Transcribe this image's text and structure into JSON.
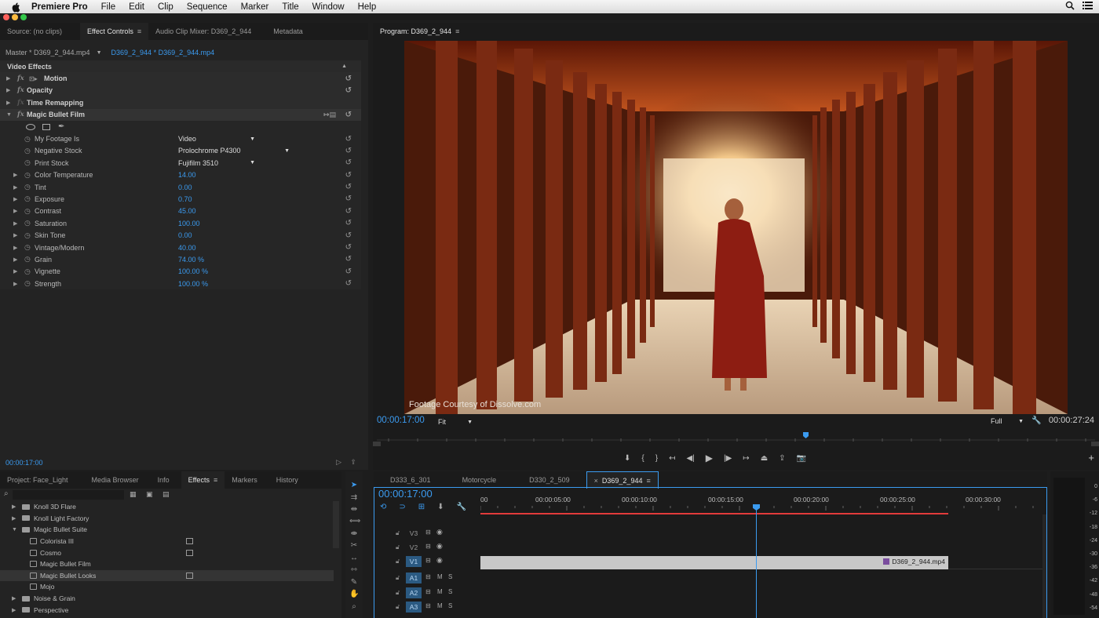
{
  "menubar": {
    "app": "Premiere Pro",
    "items": [
      "File",
      "Edit",
      "Clip",
      "Sequence",
      "Marker",
      "Title",
      "Window",
      "Help"
    ]
  },
  "effect_controls_panel": {
    "tabs": [
      {
        "label": "Source: (no clips)",
        "active": false
      },
      {
        "label": "Effect Controls",
        "active": true
      },
      {
        "label": "Audio Clip Mixer: D369_2_944",
        "active": false
      },
      {
        "label": "Metadata",
        "active": false
      }
    ],
    "master_label": "Master * D369_2_944.mp4",
    "clip_label": "D369_2_944 * D369_2_944.mp4",
    "section": "Video Effects",
    "effects": [
      "Motion",
      "Opacity",
      "Time Remapping",
      "Magic Bullet Film"
    ],
    "dropdowns": [
      {
        "label": "My Footage Is",
        "value": "Video"
      },
      {
        "label": "Negative Stock",
        "value": "Prolochrome P4300"
      },
      {
        "label": "Print Stock",
        "value": "Fujifilm 3510"
      }
    ],
    "params": [
      {
        "label": "Color Temperature",
        "value": "14.00"
      },
      {
        "label": "Tint",
        "value": "0.00"
      },
      {
        "label": "Exposure",
        "value": "0.70"
      },
      {
        "label": "Contrast",
        "value": "45.00"
      },
      {
        "label": "Saturation",
        "value": "100.00"
      },
      {
        "label": "Skin Tone",
        "value": "0.00"
      },
      {
        "label": "Vintage/Modern",
        "value": "40.00"
      },
      {
        "label": "Grain",
        "value": "74.00 %"
      },
      {
        "label": "Vignette",
        "value": "100.00 %"
      },
      {
        "label": "Strength",
        "value": "100.00 %"
      }
    ],
    "footer_timecode": "00:00:17:00"
  },
  "program_monitor": {
    "tab": "Program: D369_2_944",
    "watermark": "Footage Courtesy of Dissolve.com",
    "timecode": "00:00:17:00",
    "zoom": "Fit",
    "resolution": "Full",
    "duration": "00:00:27:24",
    "playhead_fraction": 0.604
  },
  "project_panel": {
    "tabs": [
      {
        "label": "Project: Face_Light",
        "active": false
      },
      {
        "label": "Media Browser",
        "active": false
      },
      {
        "label": "Info",
        "active": false
      },
      {
        "label": "Effects",
        "active": true
      },
      {
        "label": "Markers",
        "active": false
      },
      {
        "label": "History",
        "active": false
      }
    ],
    "items": [
      {
        "label": "Knoll 3D Flare",
        "kind": "folder",
        "accel": false,
        "sel": false
      },
      {
        "label": "Knoll Light Factory",
        "kind": "folder",
        "accel": false,
        "sel": false
      },
      {
        "label": "Magic Bullet Suite",
        "kind": "folder-open",
        "accel": false,
        "sel": false
      },
      {
        "label": "Colorista III",
        "kind": "effect",
        "accel": true,
        "sel": false
      },
      {
        "label": "Cosmo",
        "kind": "effect",
        "accel": true,
        "sel": false
      },
      {
        "label": "Magic Bullet Film",
        "kind": "effect",
        "accel": false,
        "sel": false
      },
      {
        "label": "Magic Bullet Looks",
        "kind": "effect",
        "accel": true,
        "sel": true
      },
      {
        "label": "Mojo",
        "kind": "effect",
        "accel": false,
        "sel": false
      },
      {
        "label": "Noise & Grain",
        "kind": "folder",
        "accel": false,
        "sel": false
      },
      {
        "label": "Perspective",
        "kind": "folder",
        "accel": false,
        "sel": false
      }
    ]
  },
  "timeline": {
    "tabs": [
      {
        "label": "D333_6_301",
        "active": false
      },
      {
        "label": "Motorcycle",
        "active": false
      },
      {
        "label": "D330_2_509",
        "active": false
      },
      {
        "label": "D369_2_944",
        "active": true
      }
    ],
    "timecode": "00:00:17:00",
    "ruler": [
      "00",
      "00:00:05:00",
      "00:00:10:00",
      "00:00:15:00",
      "00:00:20:00",
      "00:00:25:00",
      "00:00:30:00"
    ],
    "video_tracks": [
      "V3",
      "V2",
      "V1"
    ],
    "audio_tracks": [
      "A1",
      "A2",
      "A3"
    ],
    "clip": "D369_2_944.mp4",
    "mute_label": "M",
    "solo_label": "S"
  },
  "audio_meter": {
    "scale": [
      "0",
      "-6",
      "-12",
      "-18",
      "-24",
      "-30",
      "-36",
      "-42",
      "-48",
      "-54"
    ]
  },
  "colors": {
    "accent": "#3b9bf0",
    "panel": "#232323",
    "clip": "#c8c8c8"
  }
}
